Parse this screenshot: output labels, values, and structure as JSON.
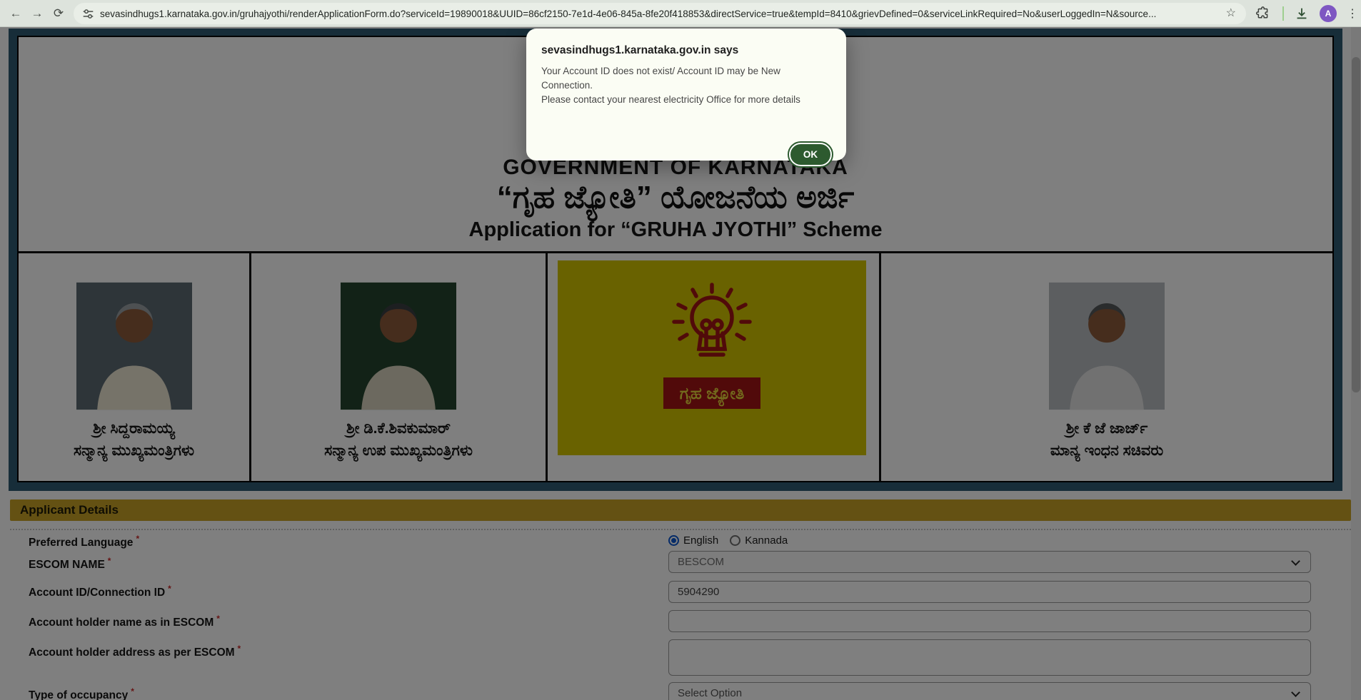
{
  "browser": {
    "url": "sevasindhugs1.karnataka.gov.in/gruhajyothi/renderApplicationForm.do?serviceId=19890018&UUID=86cf2150-7e1d-4e06-845a-8fe20f418853&directService=true&tempId=8410&grievDefined=0&serviceLinkRequired=No&userLoggedIn=N&source...",
    "avatar_letter": "A"
  },
  "dialog": {
    "title": "sevasindhugs1.karnataka.gov.in says",
    "message_line1": "Your Account ID does not exist/ Account ID may be New Connection.",
    "message_line2": "Please contact your nearest electricity Office for more details",
    "ok_label": "OK"
  },
  "banner": {
    "government": "GOVERNMENT OF KARNATAKA",
    "scheme_kannada": "“ಗೃಹ ಜ್ಯೋತಿ” ಯೋಜನೆಯ ಅರ್ಜಿ",
    "application_line": "Application for “GRUHA JYOTHI” Scheme"
  },
  "officials": [
    {
      "name": "ಶ್ರೀ ಸಿದ್ದರಾಮಯ್ಯ",
      "designation": "ಸನ್ಮಾನ್ಯ ಮುಖ್ಯಮಂತ್ರಿಗಳು"
    },
    {
      "name": "ಶ್ರೀ ಡಿ.ಕೆ.ಶಿವಕುಮಾರ್",
      "designation": "ಸನ್ಮಾನ್ಯ ಉಪ ಮುಖ್ಯಮಂತ್ರಿಗಳು"
    },
    {
      "name": "ಶ್ರೀ ಕೆ ಜೆ ಜಾರ್ಜ್",
      "designation": "ಮಾನ್ಯ ಇಂಧನ ಸಚಿವರು"
    }
  ],
  "logo": {
    "label_kannada": "ಗೃಹ ಜ್ಯೋತಿ"
  },
  "form": {
    "section_title": "Applicant Details",
    "required_marker": "*",
    "preferred_language": {
      "label": "Preferred Language",
      "options": [
        "English",
        "Kannada"
      ],
      "selected": "English"
    },
    "escom_name": {
      "label": "ESCOM NAME",
      "value": "BESCOM"
    },
    "account_id": {
      "label": "Account ID/Connection ID",
      "value": "5904290"
    },
    "holder_name": {
      "label": "Account holder name as in ESCOM",
      "value": ""
    },
    "holder_address": {
      "label": "Account holder address as per ESCOM",
      "value": ""
    },
    "occupancy": {
      "label": "Type of occupancy",
      "value": "Select Option"
    }
  },
  "colors": {
    "section_bar_gold": "#c9a227",
    "container_teal": "#2e5b73",
    "logo_yellow": "#d3c400",
    "logo_red": "#a31515",
    "ok_button_green": "#2d5a2f",
    "radio_selected_blue": "#0b57d0",
    "avatar_purple": "#7e57c2",
    "toolbar_bg": "#dde3dc"
  }
}
